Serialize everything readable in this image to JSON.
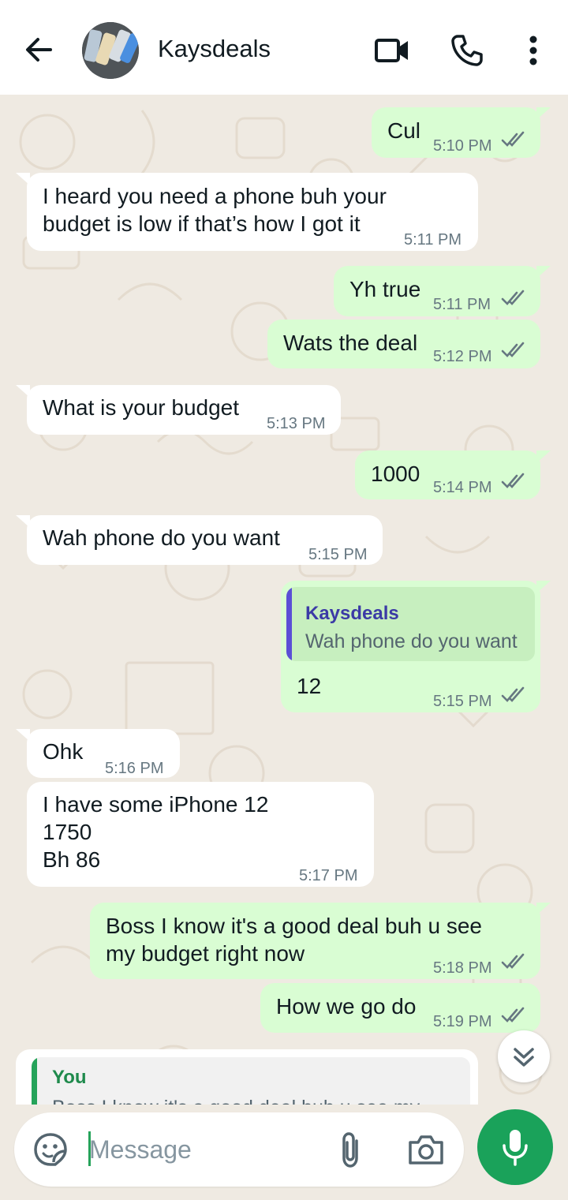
{
  "header": {
    "contact_name": "Kaysdeals"
  },
  "icons": {
    "back": "arrow-left-icon",
    "video": "video-call-icon",
    "call": "phone-icon",
    "menu": "more-vertical-icon",
    "emoji": "sticker-icon",
    "attach": "paperclip-icon",
    "camera": "camera-icon",
    "mic": "microphone-icon",
    "scroll": "double-chevron-down-icon"
  },
  "colors": {
    "outgoing_bubble": "#d9fdd3",
    "incoming_bubble": "#ffffff",
    "chat_background": "#efeae2",
    "accent_green": "#1aa25a",
    "read_ticks": "#667781"
  },
  "messages": [
    {
      "direction": "out",
      "text": "Cul",
      "time": "5:10 PM",
      "read": true
    },
    {
      "direction": "in",
      "text": "I heard you need a phone buh your\nbudget is low if that’s how I got it",
      "time": "5:11 PM"
    },
    {
      "direction": "out",
      "text": "Yh true",
      "time": "5:11 PM",
      "read": true
    },
    {
      "direction": "out",
      "text": "Wats the deal",
      "time": "5:12 PM",
      "read": true
    },
    {
      "direction": "in",
      "text": "What is your budget",
      "time": "5:13 PM"
    },
    {
      "direction": "out",
      "text": "1000",
      "time": "5:14 PM",
      "read": true
    },
    {
      "direction": "in",
      "text": "Wah phone do you want",
      "time": "5:15 PM"
    },
    {
      "direction": "out",
      "text": "12",
      "time": "5:15 PM",
      "read": true,
      "quote": {
        "author": "Kaysdeals",
        "text": "Wah phone do you want"
      }
    },
    {
      "direction": "in",
      "text": "Ohk",
      "time": "5:16 PM"
    },
    {
      "direction": "in",
      "text": "I have some iPhone 12\n1750\nBh 86",
      "time": "5:17 PM"
    },
    {
      "direction": "out",
      "text": "Boss I know it's a good deal buh u see\nmy budget right now",
      "time": "5:18 PM",
      "read": true
    },
    {
      "direction": "out",
      "text": "How we go do",
      "time": "5:19 PM",
      "read": true
    }
  ],
  "reply_preview": {
    "author": "You",
    "text": "Boss I know it's a good deal buh u see my"
  },
  "composer": {
    "placeholder": "Message"
  }
}
